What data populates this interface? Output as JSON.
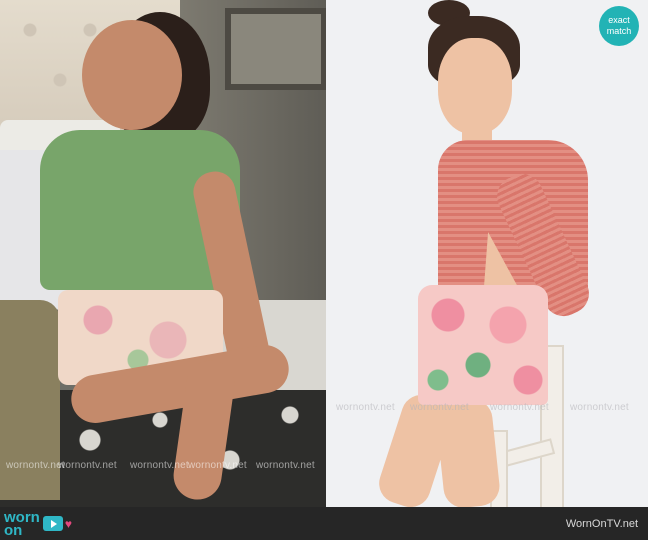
{
  "badge": {
    "line1": "exact",
    "line2": "match"
  },
  "watermarks": {
    "left": [
      "wornontv.net",
      "wornontv.net",
      "wornontv.net",
      "wornontv.net",
      "wornontv.net"
    ],
    "right": [
      "wornontv.net",
      "wornontv.net",
      "wornontv.net",
      "wornontv.net"
    ]
  },
  "footer": {
    "logo_line1": "worn",
    "logo_line2": "on",
    "site": "WornOnTV.net"
  }
}
